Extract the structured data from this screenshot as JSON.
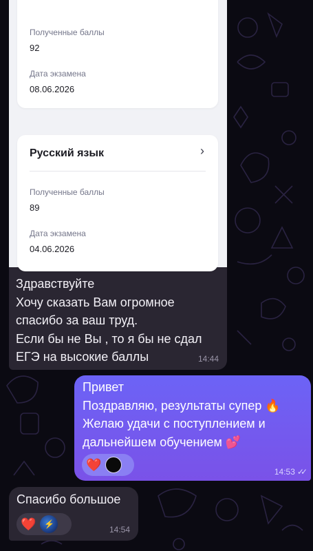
{
  "colors": {
    "chat_background": "#0b0a12",
    "incoming_bubble": "#2a2632",
    "outgoing_bubble": "#6c63f6",
    "screenshot_background": "#f1f2f6"
  },
  "screenshot": {
    "card1": {
      "score_label": "Полученные баллы",
      "score_value": "92",
      "date_label": "Дата экзамена",
      "date_value": "08.06.2026"
    },
    "card2": {
      "title": "Русский язык",
      "chevron": "›",
      "score_label": "Полученные баллы",
      "score_value": "89",
      "date_label": "Дата экзамена",
      "date_value": "04.06.2026"
    }
  },
  "messages": {
    "incoming1": {
      "lines": [
        "Здравствуйте",
        "Хочу сказать Вам огромное",
        "спасибо за ваш труд.",
        "Если бы не Вы , то я бы не сдал",
        "ЕГЭ на высокие баллы"
      ],
      "time": "14:44"
    },
    "outgoing1": {
      "lines": [
        "Привет",
        "Поздравляю, результаты супер 🔥",
        "Желаю удачи с поступлением и",
        "дальнейшем обучением 💕"
      ],
      "reaction": "❤️",
      "time": "14:53",
      "read_mark": "✓✓"
    },
    "incoming2": {
      "text": "Спасибо большое",
      "reaction": "❤️",
      "reaction_avatar_icon": "lightning-bolt",
      "time": "14:54"
    }
  }
}
